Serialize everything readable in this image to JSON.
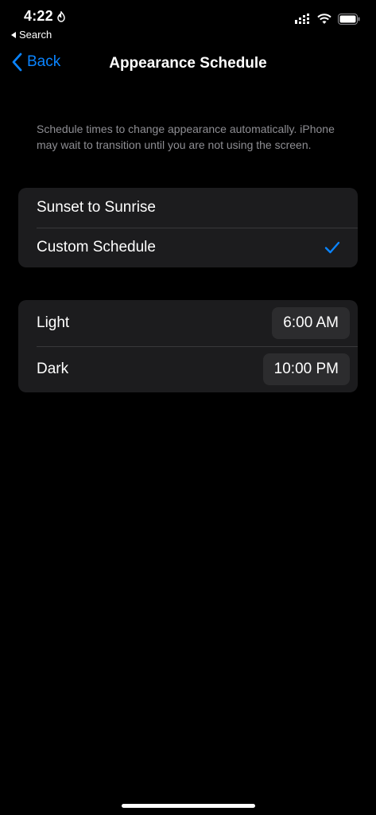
{
  "status_bar": {
    "time": "4:22",
    "back_to_app": "Search",
    "icons": [
      "focus-icon",
      "cellular-icon",
      "wifi-icon",
      "battery-icon"
    ]
  },
  "nav": {
    "back_label": "Back",
    "title": "Appearance Schedule"
  },
  "description": "Schedule times to change appearance automatically. iPhone may wait to transition until you are not using the screen.",
  "schedule_options": [
    {
      "label": "Sunset to Sunrise",
      "selected": false
    },
    {
      "label": "Custom Schedule",
      "selected": true
    }
  ],
  "times": [
    {
      "label": "Light",
      "value": "6:00 AM"
    },
    {
      "label": "Dark",
      "value": "10:00 PM"
    }
  ],
  "colors": {
    "accent": "#0a84ff",
    "background": "#000000",
    "group_background": "#1c1c1e",
    "secondary_text": "#8e8e93"
  }
}
